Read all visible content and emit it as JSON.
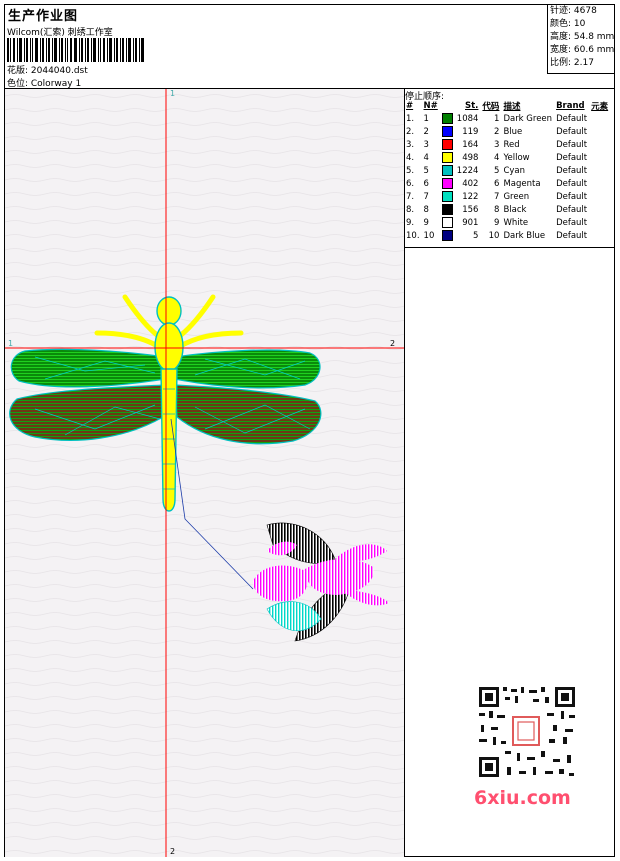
{
  "header": {
    "title": "生产作业图",
    "studio": "Wilcom(汇索) 刺绣工作室",
    "pattern": "花版: 2044040.dst",
    "colorway": "色位: Colorway 1"
  },
  "stats": {
    "stitches": "针迹: 4678",
    "colors": "颜色: 10",
    "height": "高度: 54.8 mm",
    "width": "宽度: 60.6 mm",
    "scale": "比例: 2.17"
  },
  "canvas": {
    "vertical_label_top": "1",
    "vertical_label_bottom": "2",
    "horizontal_label_left": "1",
    "horizontal_label_right": "2"
  },
  "stop_sequence": {
    "title": "停止顺序:",
    "headers": [
      "#",
      "N#",
      "St.",
      "代码",
      "描述",
      "Brand",
      "元素"
    ],
    "rows": [
      {
        "idx": "1.",
        "n": "1",
        "color": "#008000",
        "st": "1084",
        "code": "1",
        "desc": "Dark Green",
        "brand": "Default"
      },
      {
        "idx": "2.",
        "n": "2",
        "color": "#0000ff",
        "st": "119",
        "code": "2",
        "desc": "Blue",
        "brand": "Default"
      },
      {
        "idx": "3.",
        "n": "3",
        "color": "#ff0000",
        "st": "164",
        "code": "3",
        "desc": "Red",
        "brand": "Default"
      },
      {
        "idx": "4.",
        "n": "4",
        "color": "#ffff00",
        "st": "498",
        "code": "4",
        "desc": "Yellow",
        "brand": "Default"
      },
      {
        "idx": "5.",
        "n": "5",
        "color": "#00c0c0",
        "st": "1224",
        "code": "5",
        "desc": "Cyan",
        "brand": "Default"
      },
      {
        "idx": "6.",
        "n": "6",
        "color": "#ff00ff",
        "st": "402",
        "code": "6",
        "desc": "Magenta",
        "brand": "Default"
      },
      {
        "idx": "7.",
        "n": "7",
        "color": "#00e0c0",
        "st": "122",
        "code": "7",
        "desc": "Green",
        "brand": "Default"
      },
      {
        "idx": "8.",
        "n": "8",
        "color": "#000000",
        "st": "156",
        "code": "8",
        "desc": "Black",
        "brand": "Default"
      },
      {
        "idx": "9.",
        "n": "9",
        "color": "#ffffff",
        "st": "901",
        "code": "9",
        "desc": "White",
        "brand": "Default"
      },
      {
        "idx": "10.",
        "n": "10",
        "color": "#000080",
        "st": "5",
        "code": "10",
        "desc": "Dark Blue",
        "brand": "Default"
      }
    ]
  },
  "watermark": {
    "brand_text": "6xiu.com"
  }
}
